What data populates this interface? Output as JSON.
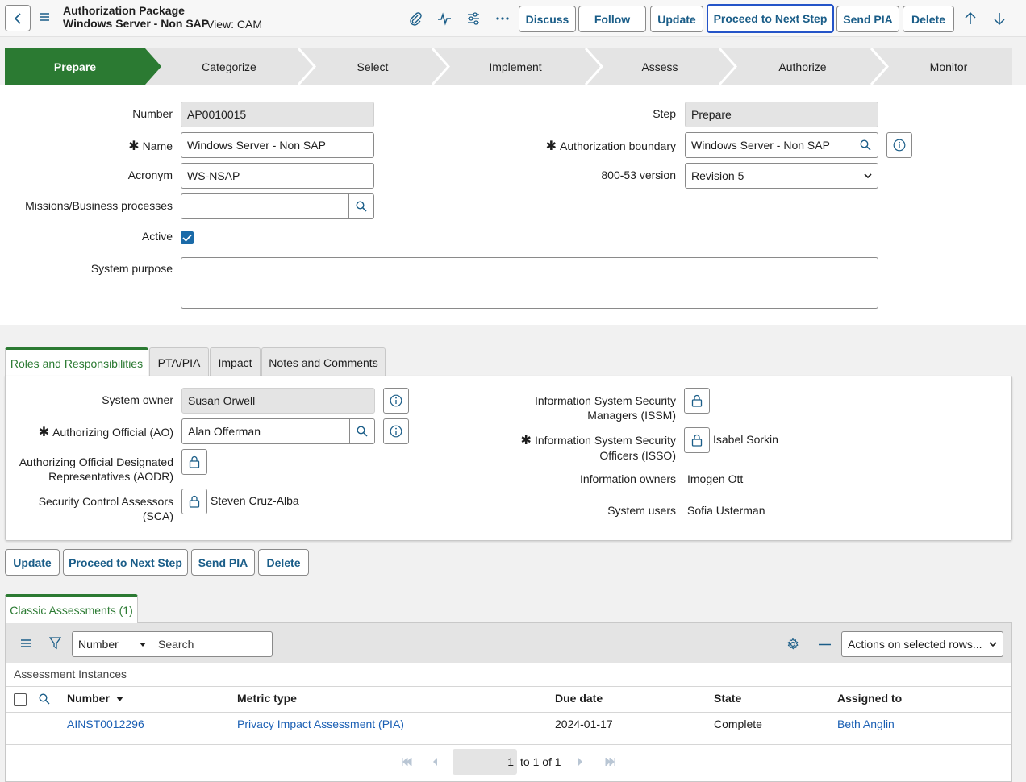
{
  "header": {
    "title_line1": "Authorization Package",
    "title_line2": "Windows Server - Non SAP",
    "view_label": "View: CAM",
    "buttons": {
      "discuss": "Discuss",
      "follow": "Follow",
      "update": "Update",
      "proceed": "Proceed to Next Step",
      "send_pia": "Send PIA",
      "delete": "Delete"
    }
  },
  "workflow": {
    "steps": [
      "Prepare",
      "Categorize",
      "Select",
      "Implement",
      "Assess",
      "Authorize",
      "Monitor"
    ],
    "active": "Prepare",
    "active_color": "#2b7a32"
  },
  "form": {
    "number_label": "Number",
    "number_value": "AP0010015",
    "name_label": "Name",
    "name_value": "Windows Server - Non SAP",
    "acronym_label": "Acronym",
    "acronym_value": "WS-NSAP",
    "missions_label": "Missions/Business processes",
    "missions_value": "",
    "active_label": "Active",
    "active_checked": true,
    "system_purpose_label": "System purpose",
    "system_purpose_value": "",
    "step_label": "Step",
    "step_value": "Prepare",
    "auth_boundary_label": "Authorization boundary",
    "auth_boundary_value": "Windows Server - Non SAP",
    "version_label": "800-53 version",
    "version_value": "Revision 5",
    "required_mark": "✱"
  },
  "tabs": [
    "Roles and Responsibilities",
    "PTA/PIA",
    "Impact",
    "Notes and Comments"
  ],
  "roles": {
    "system_owner_label": "System owner",
    "system_owner_value": "Susan Orwell",
    "ao_label": "Authorizing Official (AO)",
    "ao_value": "Alan Offerman",
    "aodr_label_1": "Authorizing Official Designated",
    "aodr_label_2": "Representatives (AODR)",
    "sca_label_1": "Security Control Assessors",
    "sca_label_2": "(SCA)",
    "sca_value": "Steven Cruz-Alba",
    "issm_label_1": "Information System Security",
    "issm_label_2": "Managers (ISSM)",
    "isso_label_1": "Information System Security",
    "isso_label_2": "Officers (ISSO)",
    "isso_value": "Isabel Sorkin",
    "info_owners_label": "Information owners",
    "info_owners_value": "Imogen Ott",
    "system_users_label": "System users",
    "system_users_value": "Sofia Usterman"
  },
  "bottom_buttons": {
    "update": "Update",
    "proceed": "Proceed to Next Step",
    "send_pia": "Send PIA",
    "delete": "Delete"
  },
  "related_list": {
    "tab_label": "Classic Assessments (1)",
    "filter_field": "Number",
    "search_placeholder": "Search",
    "actions_label": "Actions on selected rows...",
    "caption": "Assessment Instances",
    "columns": [
      "Number",
      "Metric type",
      "Due date",
      "State",
      "Assigned to"
    ],
    "rows": [
      {
        "number": "AINST0012296",
        "metric_type": "Privacy Impact Assessment (PIA)",
        "due_date": "2024-01-17",
        "state": "Complete",
        "assigned_to": "Beth Anglin"
      }
    ],
    "pager": {
      "page": "1",
      "range_text": "to 1 of 1"
    }
  }
}
